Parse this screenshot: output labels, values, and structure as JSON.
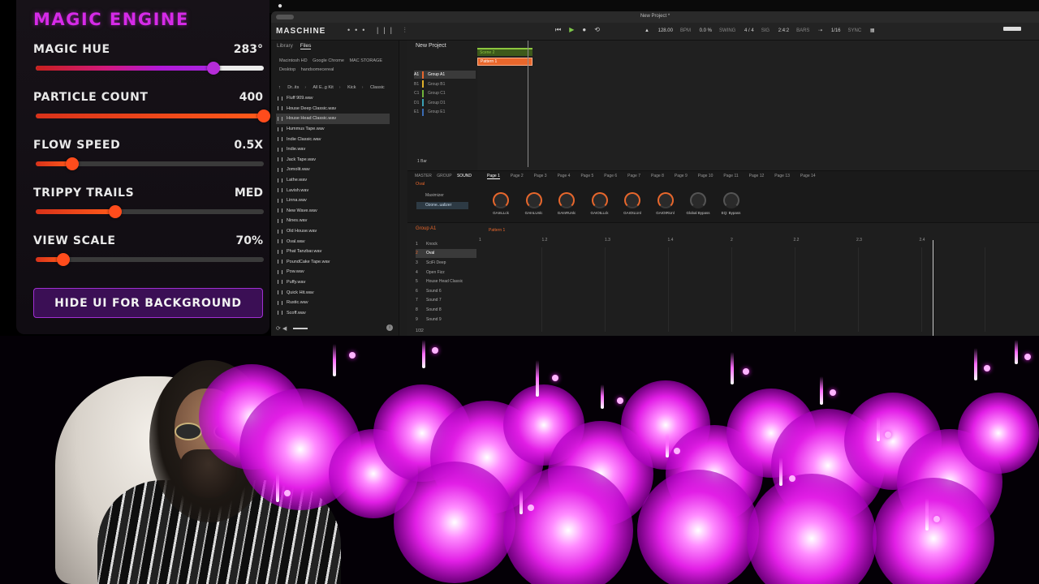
{
  "magic_engine": {
    "title": "MAGIC ENGINE",
    "controls": [
      {
        "id": "hue",
        "label": "MAGIC HUE",
        "value": "283°",
        "level": 0.78
      },
      {
        "id": "count",
        "label": "PARTICLE COUNT",
        "value": "400",
        "level": 1.0
      },
      {
        "id": "speed",
        "label": "FLOW SPEED",
        "value": "0.5X",
        "level": 0.16
      },
      {
        "id": "trails",
        "label": "TRIPPY TRAILS",
        "value": "MED",
        "level": 0.35
      },
      {
        "id": "scale",
        "label": "VIEW SCALE",
        "value": "70%",
        "level": 0.12
      }
    ],
    "hide_button": "HIDE UI FOR BACKGROUND"
  },
  "maschine": {
    "window_title": "New Project *",
    "logo": "MASCHINE",
    "toolbar": {
      "tempo": "128.00",
      "tempo_unit": "BPM",
      "swing": "0.0 %",
      "swing_label": "SWING",
      "signature": "4 / 4",
      "signature_label": "SIG",
      "position": "2:4:2",
      "position_label": "BARS",
      "grid": "1/16",
      "sync_label": "SYNC"
    },
    "browser": {
      "tabs": [
        "Library",
        "Files"
      ],
      "active_tab": "Files",
      "locations": [
        "Macintosh HD",
        "Google Chrome",
        "MAC STORAGE",
        "Desktop",
        "handsomecereal"
      ],
      "breadcrumb": [
        "Dr..its",
        "All E..g Kit",
        "Kick",
        "Classic"
      ],
      "files": [
        "Fluff 909.wav",
        "House Deep Classic.wav",
        "House Head Classic.wav",
        "Hummus Tape.wav",
        "Indie Classic.wav",
        "Indie.wav",
        "Jack Tape.wav",
        "Jomolit.wav",
        "Lathe.wav",
        "Lavish.wav",
        "Linna.wav",
        "New Wave.wav",
        "Nines.wav",
        "Old House.wav",
        "Oval.wav",
        "Phat Tanzbar.wav",
        "PoundCake Tape.wav",
        "Pow.wav",
        "Puffy.wav",
        "Quick Hit.wav",
        "Rustic.wav",
        "Scoff.wav"
      ],
      "selected_file": "House Head Classic.wav"
    },
    "arranger": {
      "project": "New Project",
      "groups": [
        {
          "id": "A1",
          "name": "Group A1",
          "color": "#e8672c"
        },
        {
          "id": "B1",
          "name": "Group B1",
          "color": "#e0b02a"
        },
        {
          "id": "C1",
          "name": "Group C1",
          "color": "#6fb33a"
        },
        {
          "id": "D1",
          "name": "Group D1",
          "color": "#3aa0b3"
        },
        {
          "id": "E1",
          "name": "Group E1",
          "color": "#3a6bb3"
        }
      ],
      "scene": "Scene 2",
      "pattern": "Pattern 1",
      "bar_length": "1 Bar"
    },
    "plugin": {
      "tabs": [
        "MASTER",
        "GROUP",
        "SOUND"
      ],
      "active_tab": "SOUND",
      "pages": [
        "Page 1",
        "Page 2",
        "Page 3",
        "Page 4",
        "Page 5",
        "Page 6",
        "Page 7",
        "Page 8",
        "Page 9",
        "Page 10",
        "Page 11",
        "Page 12",
        "Page 13",
        "Page 14"
      ],
      "sound_name": "Oval",
      "slots": [
        "Maximizer",
        "Ozone..ualizer"
      ],
      "knobs": [
        {
          "label": "GAInLLck",
          "on": true
        },
        {
          "label": "GAInLUnlc",
          "on": true
        },
        {
          "label": "GAInRUnlc",
          "on": true
        },
        {
          "label": "GAIOtLLck",
          "on": true
        },
        {
          "label": "GAIOtLUnl",
          "on": true
        },
        {
          "label": "GAIOtRUnl",
          "on": true
        },
        {
          "label": "Global Bypass",
          "on": false
        },
        {
          "label": "EQ: Bypass",
          "on": false
        }
      ]
    },
    "pattern_editor": {
      "group": "Group A1",
      "pattern": "Pattern 1",
      "ruler": [
        "1",
        "1.2",
        "1.3",
        "1.4",
        "2",
        "2.2",
        "2.3",
        "2.4"
      ],
      "sounds": [
        "Knock",
        "Oval",
        "SciFi Deep",
        "Open Fizz",
        "House Head Classic",
        "Sound 6",
        "Sound 7",
        "Sound 8",
        "Sound 9"
      ],
      "selected_sound": "Oval",
      "grid": "1/32"
    }
  }
}
